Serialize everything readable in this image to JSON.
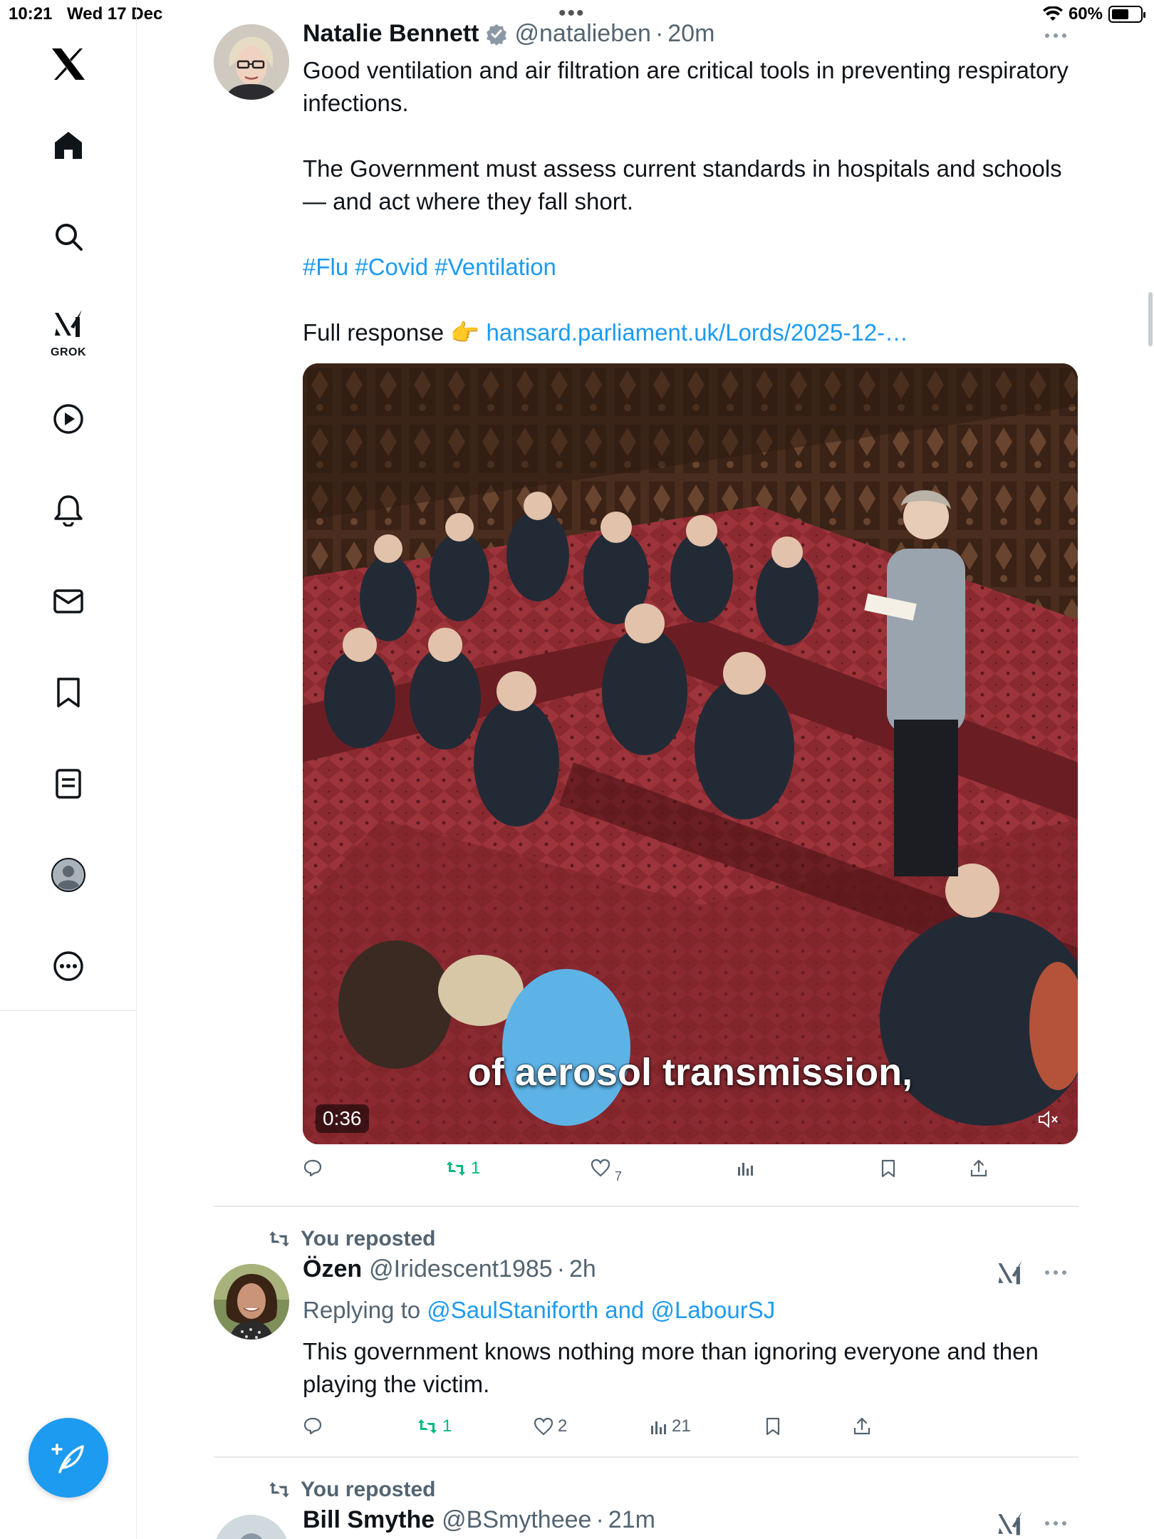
{
  "status_bar": {
    "time": "10:21",
    "date": "Wed 17 Dec",
    "battery": "60%",
    "battery_level": 0.6
  },
  "sidebar": {
    "grok_label": "GROK",
    "items": [
      {
        "name": "home"
      },
      {
        "name": "explore"
      },
      {
        "name": "grok"
      },
      {
        "name": "video"
      },
      {
        "name": "notifications"
      },
      {
        "name": "messages"
      },
      {
        "name": "bookmarks"
      },
      {
        "name": "lists"
      },
      {
        "name": "profile"
      },
      {
        "name": "more"
      }
    ]
  },
  "tweets": [
    {
      "author_name": "Natalie Bennett",
      "author_handle": "@natalieben",
      "time": "20m",
      "verified": true,
      "text_1": "Good ventilation and air filtration are critical tools in preventing respiratory infections.",
      "text_2": "The Government must assess current standards in hospitals and schools — and act where they fall short.",
      "hashtags": "#Flu #Covid #Ventilation",
      "link_prefix": "Full response 👉 ",
      "link": "hansard.parliament.uk/Lords/2025-12-…",
      "video_caption": "of aerosol transmission,",
      "video_duration": "0:36",
      "reposts": "1",
      "likes": "7",
      "views": "",
      "reposted_by_me": true
    },
    {
      "repost_label": "You reposted",
      "author_name": "Özen",
      "author_handle": "@Iridescent1985",
      "time": "2h",
      "replying_to_label": "Replying to ",
      "replying_to": "@SaulStaniforth and @LabourSJ",
      "text": "This government knows nothing more than ignoring everyone and then playing the victim.",
      "reposts": "1",
      "likes": "2",
      "views": "21"
    },
    {
      "repost_label": "You reposted",
      "author_name": "Bill Smythe",
      "author_handle": "@BSmytheee",
      "time": "21m"
    }
  ],
  "colors": {
    "accent": "#1d9bf0",
    "repost_green": "#00ba7c",
    "secondary_text": "#536471",
    "leather_red": "#8a2a30"
  }
}
